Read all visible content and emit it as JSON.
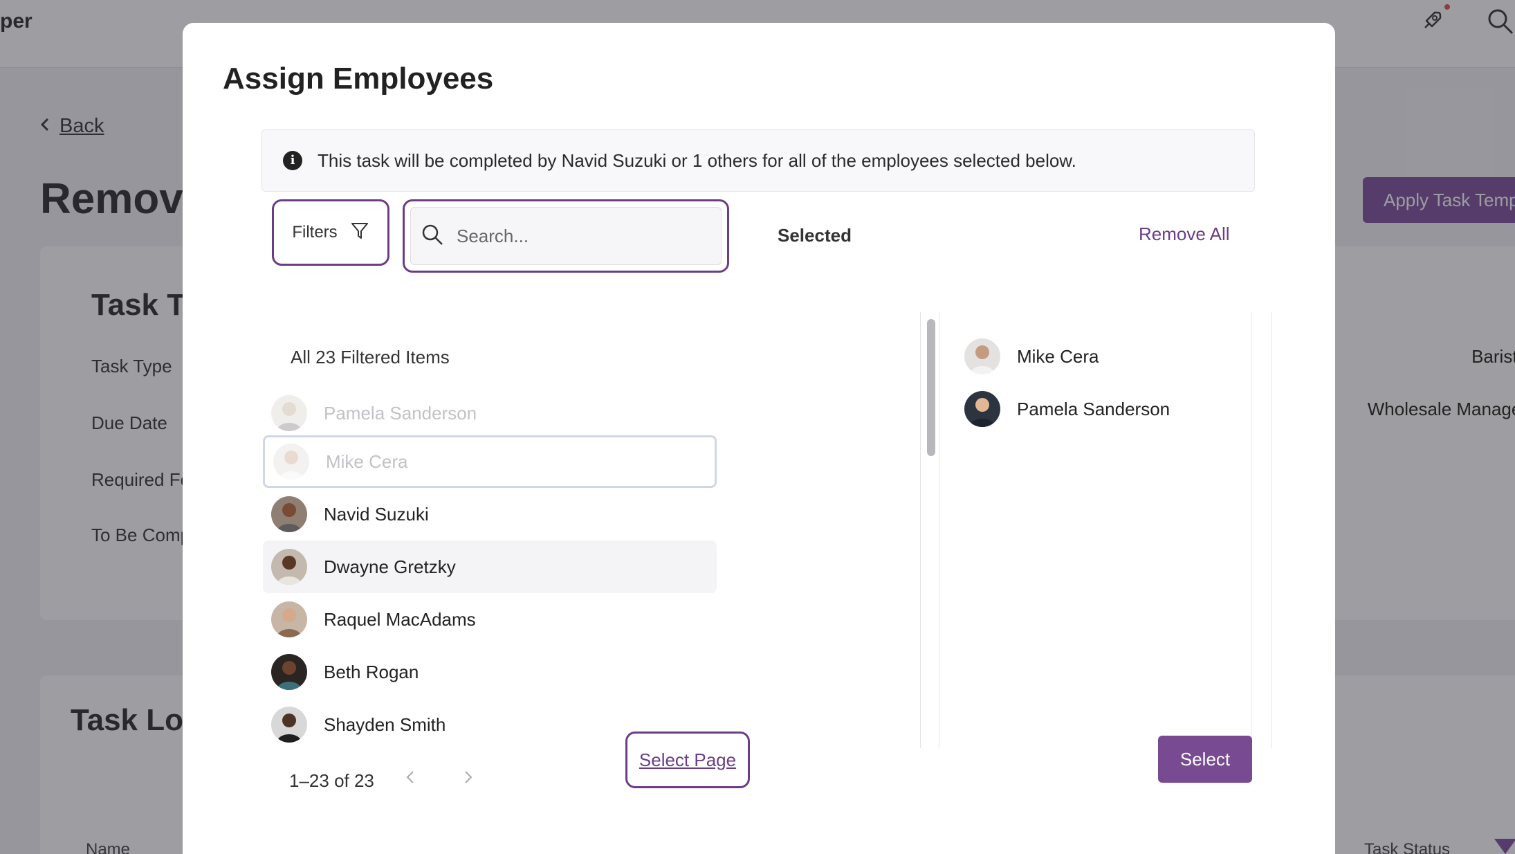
{
  "background": {
    "brand_fragment": "per",
    "back_label": "Back",
    "page_title_fragment": "Remov",
    "apply_button": "Apply Task Temp",
    "task_card": {
      "title_fragment": "Task T",
      "rows": [
        "Task Type",
        "Due Date",
        "Required Fo",
        "To Be Comp"
      ]
    },
    "log_card": {
      "title_fragment": "Task Log",
      "columns_fragment": "Name",
      "status_column": "Task Status"
    }
  },
  "modal": {
    "title": "Assign Employees",
    "info_text": "This task will be completed by Navid Suzuki or 1 others for all of the employees selected below.",
    "filters_label": "Filters",
    "search_placeholder": "Search...",
    "selected_label": "Selected",
    "remove_all_label": "Remove All",
    "list_header": "All 23 Filtered Items",
    "employees": [
      {
        "name": "Pamela Sanderson",
        "state": "disabled"
      },
      {
        "name": "Mike Cera",
        "state": "disabled-focused"
      },
      {
        "name": "Navid Suzuki",
        "state": "normal"
      },
      {
        "name": "Dwayne Gretzky",
        "state": "hover"
      },
      {
        "name": "Raquel MacAdams",
        "state": "normal"
      },
      {
        "name": "Beth Rogan",
        "state": "normal"
      },
      {
        "name": "Shayden Smith",
        "state": "normal"
      }
    ],
    "selected": [
      {
        "name": "Mike Cera",
        "role": "Barista"
      },
      {
        "name": "Pamela Sanderson",
        "role": "Wholesale Manager"
      }
    ],
    "pagination": "1–23 of 23",
    "select_page_label": "Select Page",
    "select_button": "Select"
  },
  "colors": {
    "accent": "#6b3d87",
    "button": "#774a92"
  }
}
